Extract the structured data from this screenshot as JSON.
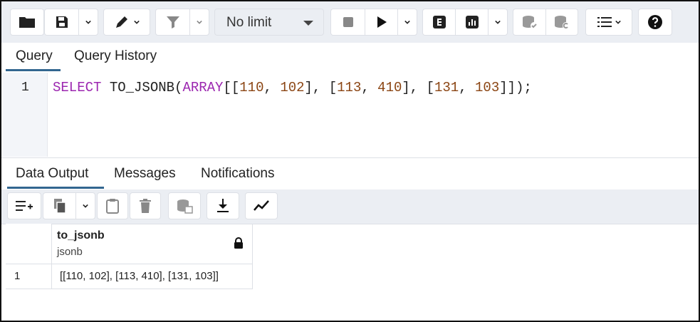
{
  "toolbar": {
    "limit_label": "No limit",
    "icons": [
      "folder-open-icon",
      "save-icon",
      "chevron-down-icon",
      "pen-icon",
      "filter-icon",
      "stop-icon",
      "play-icon",
      "explain-icon",
      "explain-analyze-icon",
      "commit-icon",
      "rollback-icon",
      "macros-icon",
      "help-icon"
    ]
  },
  "query_tabs": {
    "query": "Query",
    "history": "Query History"
  },
  "editor": {
    "line_number": "1",
    "code": {
      "select": "SELECT",
      "fn": "TO_JSONB",
      "open_paren": "(",
      "array": "ARRAY",
      "open_outer": "[",
      "n1": "110",
      "n2": "102",
      "n3": "113",
      "n4": "410",
      "n5": "131",
      "n6": "103",
      "end": ");"
    }
  },
  "result_tabs": {
    "data_output": "Data Output",
    "messages": "Messages",
    "notifications": "Notifications"
  },
  "grid": {
    "column": {
      "name": "to_jsonb",
      "type": "jsonb"
    },
    "rows": [
      {
        "num": "1",
        "value": "[[110, 102], [113, 410], [131, 103]]"
      }
    ]
  },
  "colors": {
    "accent": "#326690",
    "keyword": "#9c27b0",
    "number": "#8b4513",
    "toolbar_bg": "#ebeef3"
  }
}
